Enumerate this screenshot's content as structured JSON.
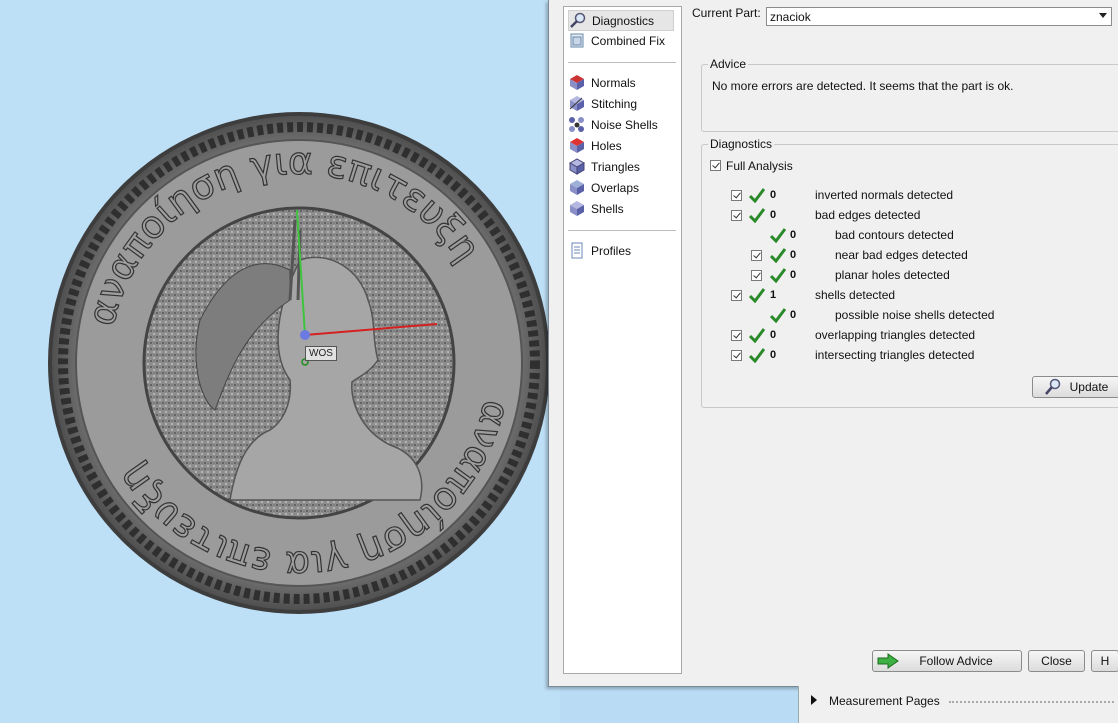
{
  "viewport": {
    "wos_label": "WOS"
  },
  "nav": {
    "items": [
      {
        "label": "Diagnostics",
        "icon": "magnifier-icon"
      },
      {
        "label": "Combined Fix",
        "icon": "combined-fix-icon"
      },
      {
        "label": "Normals",
        "icon": "normals-cube-icon"
      },
      {
        "label": "Stitching",
        "icon": "stitching-cube-icon"
      },
      {
        "label": "Noise Shells",
        "icon": "noise-shells-icon"
      },
      {
        "label": "Holes",
        "icon": "holes-cube-icon"
      },
      {
        "label": "Triangles",
        "icon": "triangles-cube-icon"
      },
      {
        "label": "Overlaps",
        "icon": "overlaps-cube-icon"
      },
      {
        "label": "Shells",
        "icon": "shells-cube-icon"
      },
      {
        "label": "Profiles",
        "icon": "profiles-icon"
      }
    ]
  },
  "current_part": {
    "label": "Current Part:",
    "value": "znaciok"
  },
  "advice": {
    "title": "Advice",
    "text": "No more errors are detected. It seems that the part is ok."
  },
  "diagnostics": {
    "title": "Diagnostics",
    "full_analysis_label": "Full Analysis",
    "rows": [
      {
        "count": "0",
        "text": "inverted normals detected"
      },
      {
        "count": "0",
        "text": "bad edges detected"
      },
      {
        "count": "0",
        "text": "bad contours detected"
      },
      {
        "count": "0",
        "text": "near bad edges detected"
      },
      {
        "count": "0",
        "text": "planar holes detected"
      },
      {
        "count": "1",
        "text": "shells detected"
      },
      {
        "count": "0",
        "text": "possible noise shells detected"
      },
      {
        "count": "0",
        "text": "overlapping triangles detected"
      },
      {
        "count": "0",
        "text": "intersecting triangles detected"
      }
    ],
    "update_label": "Update"
  },
  "footer": {
    "follow_advice_label": "Follow Advice",
    "close_label": "Close",
    "help_label": "H"
  },
  "measurement": {
    "label": "Measurement Pages"
  },
  "colors": {
    "check_green": "#2a8a2a",
    "accent_green": "#3cb043"
  }
}
